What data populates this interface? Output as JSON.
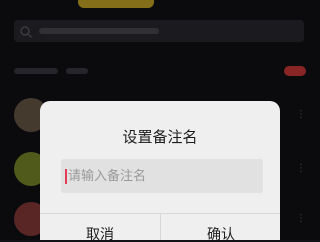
{
  "dialog": {
    "title": "设置备注名",
    "input": {
      "placeholder": "请输入备注名",
      "value": ""
    },
    "cancel_label": "取消",
    "confirm_label": "确认"
  },
  "colors": {
    "dialog_background": "#efefef",
    "input_background": "#e1e1e1",
    "caret": "#e23c5a",
    "page_background": "#121216",
    "accent_bar": "#d8b22a",
    "badge": "#d43a3a"
  },
  "icons": {
    "search": "search-icon",
    "more": "more-icon"
  }
}
